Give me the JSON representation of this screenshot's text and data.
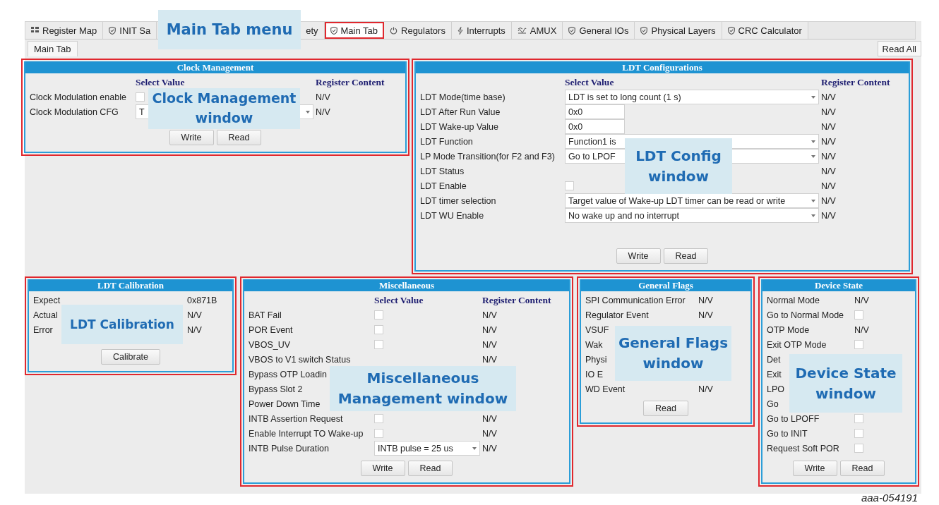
{
  "tab_bar": {
    "callout": "Main Tab menu",
    "tabs": [
      {
        "kind": "grid",
        "label": "Register Map",
        "selected": false,
        "highlighted": false
      },
      {
        "kind": "shield",
        "label": "INIT Sa",
        "selected": false,
        "highlighted": false
      },
      {
        "kind": "plain",
        "label": "ety",
        "selected": false,
        "highlighted": false
      },
      {
        "kind": "shield",
        "label": "Main Tab",
        "selected": true,
        "highlighted": true
      },
      {
        "kind": "power",
        "label": "Regulators",
        "selected": false,
        "highlighted": false
      },
      {
        "kind": "bolt",
        "label": "Interrupts",
        "selected": false,
        "highlighted": false
      },
      {
        "kind": "wave",
        "label": "AMUX",
        "selected": false,
        "highlighted": false
      },
      {
        "kind": "shield",
        "label": "General IOs",
        "selected": false,
        "highlighted": false
      },
      {
        "kind": "shield",
        "label": "Physical Layers",
        "selected": false,
        "highlighted": false
      },
      {
        "kind": "shield",
        "label": "CRC Calculator",
        "selected": false,
        "highlighted": false
      }
    ]
  },
  "subtab": "Main Tab",
  "read_all_button": "Read All",
  "panels": [
    {
      "title": "Clock Management",
      "highlighted": true,
      "callout": "Clock Management window",
      "headers": [
        "Select Value",
        "Register Content"
      ],
      "rows": [
        {
          "kind": "checkbox",
          "label": "Clock Modulation enable",
          "checked": false,
          "content": "N/V"
        },
        {
          "kind": "select",
          "label": "Clock Modulation CFG",
          "value": "T",
          "content": "N/V"
        }
      ],
      "buttons": [
        "Write",
        "Read"
      ]
    },
    {
      "title": "LDT Configurations",
      "highlighted": true,
      "callout": "LDT Config window",
      "headers": [
        "Select Value",
        "Register Content"
      ],
      "rows": [
        {
          "kind": "select",
          "label": "LDT Mode(time base)",
          "value": "LDT is set to long count (1 s)",
          "content": "N/V"
        },
        {
          "kind": "input",
          "label": "LDT After Run Value",
          "value": "0x0",
          "content": "N/V"
        },
        {
          "kind": "input",
          "label": "LDT Wake-up Value",
          "value": "0x0",
          "content": "N/V"
        },
        {
          "kind": "select",
          "label": "LDT Function",
          "value": "Function1 is",
          "content": "N/V"
        },
        {
          "kind": "select",
          "label": "LP Mode Transition(for F2 and F3)",
          "value": "Go to LPOF",
          "content": "N/V"
        },
        {
          "kind": "text",
          "label": "LDT Status",
          "content": "N/V"
        },
        {
          "kind": "checkbox",
          "label": "LDT Enable",
          "checked": false,
          "content": "N/V"
        },
        {
          "kind": "select",
          "label": "LDT timer selection",
          "value": "Target value of Wake-up LDT timer can be read or write",
          "content": "N/V"
        },
        {
          "kind": "select",
          "label": "LDT WU Enable",
          "value": "No wake up and no interrupt",
          "content": "N/V"
        }
      ],
      "buttons": [
        "Write",
        "Read"
      ]
    },
    {
      "title": "LDT Calibration",
      "highlighted": true,
      "callout": "LDT Calibration",
      "rows": [
        {
          "kind": "text",
          "label": "Expect",
          "content": "0x871B"
        },
        {
          "kind": "text",
          "label": "Actual",
          "content": "N/V"
        },
        {
          "kind": "text",
          "label": "Error",
          "content": "N/V"
        }
      ],
      "buttons": [
        "Calibrate"
      ]
    },
    {
      "title": "Miscellaneous",
      "highlighted": true,
      "callout": "Miscellaneous Management window",
      "headers": [
        "Select Value",
        "Register Content"
      ],
      "rows": [
        {
          "kind": "checkbox",
          "label": "BAT Fail",
          "checked": false,
          "content": "N/V"
        },
        {
          "kind": "checkbox",
          "label": "POR Event",
          "checked": false,
          "content": "N/V"
        },
        {
          "kind": "checkbox",
          "label": "VBOS_UV",
          "checked": false,
          "content": "N/V"
        },
        {
          "kind": "text",
          "label": "VBOS to V1 switch Status",
          "content": "N/V"
        },
        {
          "kind": "none",
          "label": "Bypass OTP Loadin"
        },
        {
          "kind": "none",
          "label": "Bypass Slot 2"
        },
        {
          "kind": "none",
          "label": "Power Down Time"
        },
        {
          "kind": "checkbox",
          "label": "INTB Assertion Request",
          "checked": false,
          "content": "N/V"
        },
        {
          "kind": "checkbox",
          "label": "Enable Interrupt TO Wake-up",
          "checked": false,
          "content": "N/V"
        },
        {
          "kind": "select",
          "label": "INTB Pulse Duration",
          "value": "INTB pulse = 25 us",
          "content": "N/V"
        }
      ],
      "buttons": [
        "Write",
        "Read"
      ]
    },
    {
      "title": "General Flags",
      "highlighted": true,
      "callout": "General Flags window",
      "rows": [
        {
          "kind": "text",
          "label": "SPI Communication Error",
          "content": "N/V"
        },
        {
          "kind": "text",
          "label": "Regulator Event",
          "content": "N/V"
        },
        {
          "kind": "none",
          "label": "VSUF"
        },
        {
          "kind": "none",
          "label": "Wak"
        },
        {
          "kind": "none",
          "label": "Physi"
        },
        {
          "kind": "none",
          "label": "IO E"
        },
        {
          "kind": "text",
          "label": "WD Event",
          "content": "N/V"
        }
      ],
      "buttons": [
        "Read"
      ]
    },
    {
      "title": "Device State",
      "highlighted": true,
      "callout": "Device State window",
      "rows": [
        {
          "kind": "text",
          "label": "Normal Mode",
          "content": "N/V"
        },
        {
          "kind": "checkbox",
          "label": "Go to Normal Mode",
          "checked": false
        },
        {
          "kind": "text",
          "label": "OTP Mode",
          "content": "N/V"
        },
        {
          "kind": "checkbox",
          "label": "Exit OTP Mode",
          "checked": false
        },
        {
          "kind": "none",
          "label": "Det"
        },
        {
          "kind": "none",
          "label": "Exit"
        },
        {
          "kind": "none",
          "label": "LPO"
        },
        {
          "kind": "none",
          "label": "Go"
        },
        {
          "kind": "checkbox",
          "label": "Go to LPOFF",
          "checked": false
        },
        {
          "kind": "checkbox",
          "label": "Go to INIT",
          "checked": false
        },
        {
          "kind": "checkbox",
          "label": "Request Soft POR",
          "checked": false
        }
      ],
      "buttons": [
        "Write",
        "Read"
      ]
    }
  ],
  "figure_id": "aaa-054191"
}
